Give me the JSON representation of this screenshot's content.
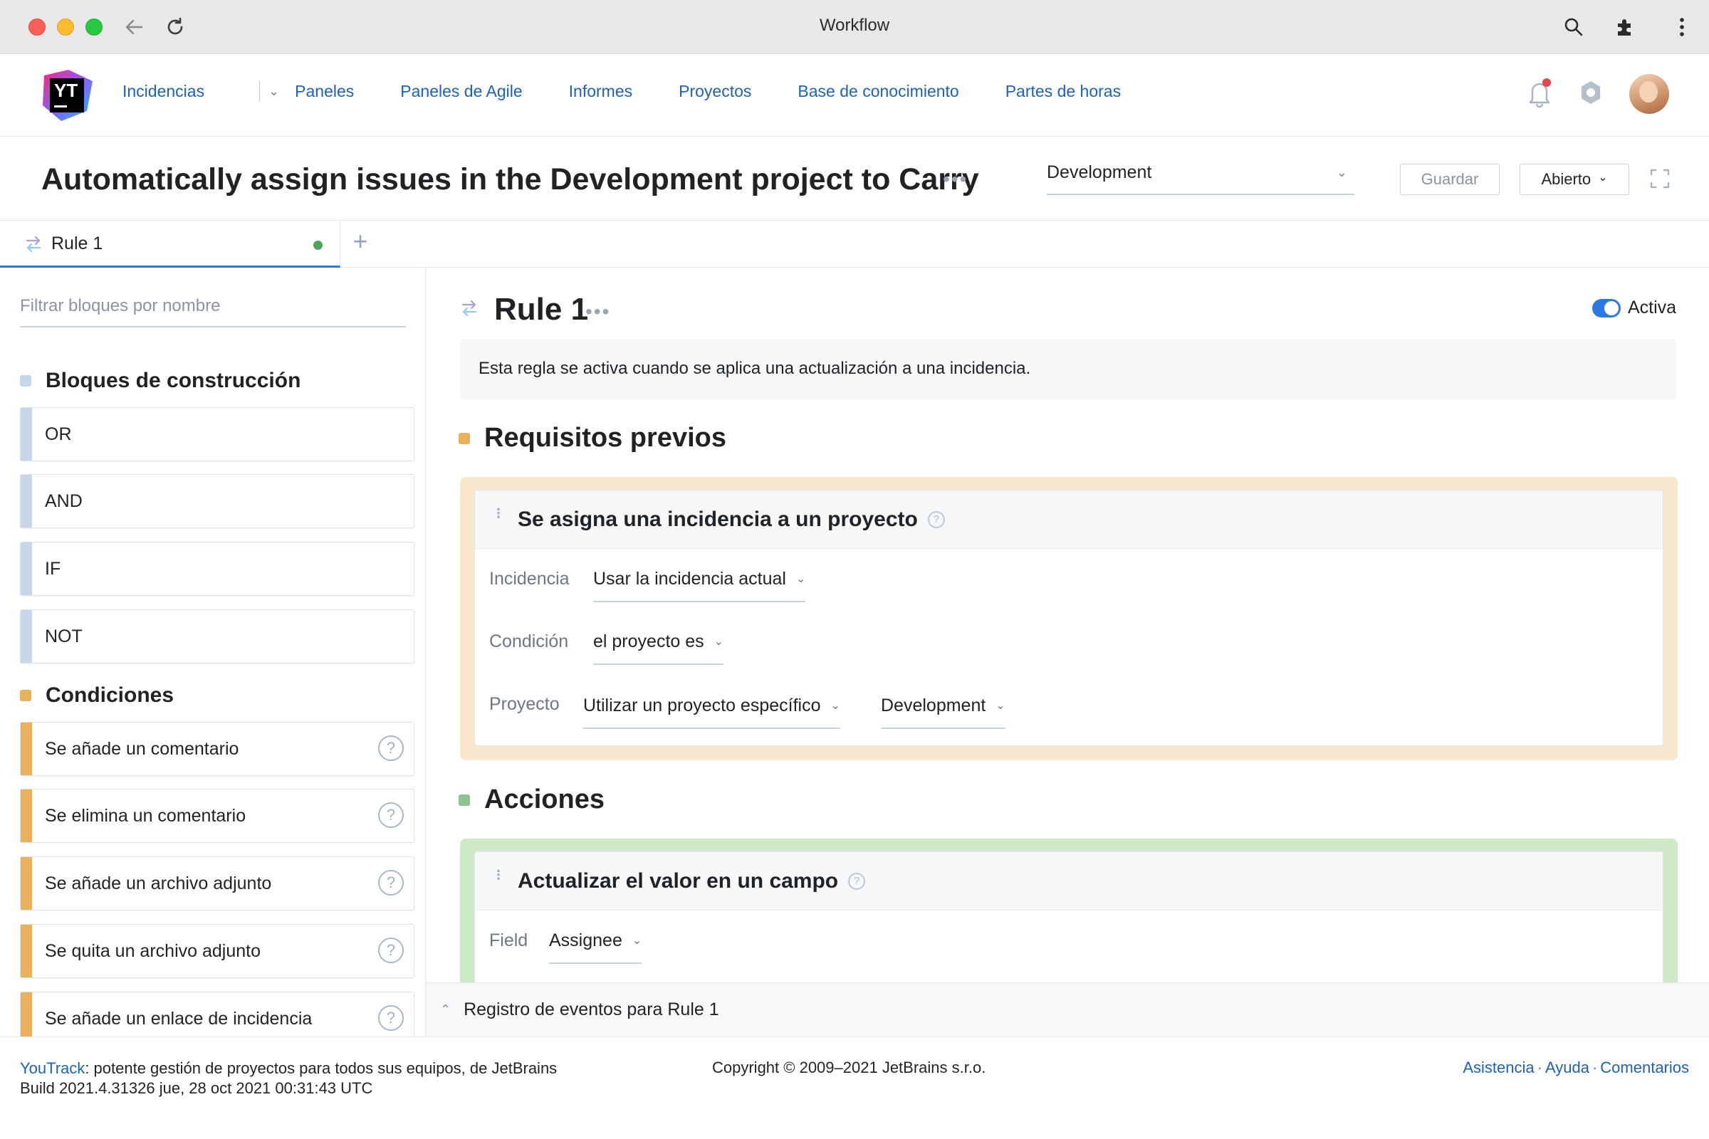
{
  "browser": {
    "title": "Workflow"
  },
  "nav": {
    "items": [
      "Incidencias",
      "Paneles",
      "Paneles de Agile",
      "Informes",
      "Proyectos",
      "Base de conocimiento",
      "Partes de horas"
    ]
  },
  "logo": {
    "text": "YT"
  },
  "page": {
    "title": "Automatically assign issues in the Development project to Carry",
    "project_value": "Development",
    "save_label": "Guardar",
    "state_label": "Abierto"
  },
  "tabs": {
    "items": [
      {
        "label": "Rule 1"
      }
    ],
    "add_label": "+"
  },
  "sidebar": {
    "filter_placeholder": "Filtrar bloques por nombre",
    "building_title": "Bloques de construcción",
    "building_blocks": [
      "OR",
      "AND",
      "IF",
      "NOT"
    ],
    "conditions_title": "Condiciones",
    "conditions": [
      "Se añade un comentario",
      "Se elimina un comentario",
      "Se añade un archivo adjunto",
      "Se quita un archivo adjunto",
      "Se añade un enlace de incidencia"
    ]
  },
  "rule": {
    "title": "Rule 1",
    "active_label": "Activa",
    "description": "Esta regla se activa cuando se aplica una actualización a una incidencia.",
    "prereq_title": "Requisitos previos",
    "prereq_card": {
      "title": "Se asigna una incidencia a un proyecto",
      "issue_label": "Incidencia",
      "issue_value": "Usar la incidencia actual",
      "condition_label": "Condición",
      "condition_value": "el proyecto es",
      "project_label": "Proyecto",
      "project_mode": "Utilizar un proyecto específico",
      "project_value": "Development"
    },
    "actions_title": "Acciones",
    "action_card": {
      "title": "Actualizar el valor en un campo",
      "field_label": "Field",
      "field_value": "Assignee"
    },
    "eventlog_label": "Registro de eventos para Rule 1"
  },
  "footer": {
    "brand_link": "YouTrack",
    "tagline": ": potente gestión de proyectos para todos sus equipos, de JetBrains",
    "build": "Build 2021.4.31326 jue, 28 oct 2021 00:31:43 UTC",
    "copyright": "Copyright © 2009–2021 JetBrains s.r.o.",
    "links": [
      "Asistencia",
      "Ayuda",
      "Comentarios"
    ]
  },
  "colors": {
    "accent": "#2a7ae2",
    "link": "#1d62b8",
    "building": "#c7d7ea",
    "conditions": "#e9b25a",
    "actions": "#8fc38f",
    "prereq_wrap": "#f8e7cd",
    "action_wrap": "#cde9c8"
  }
}
